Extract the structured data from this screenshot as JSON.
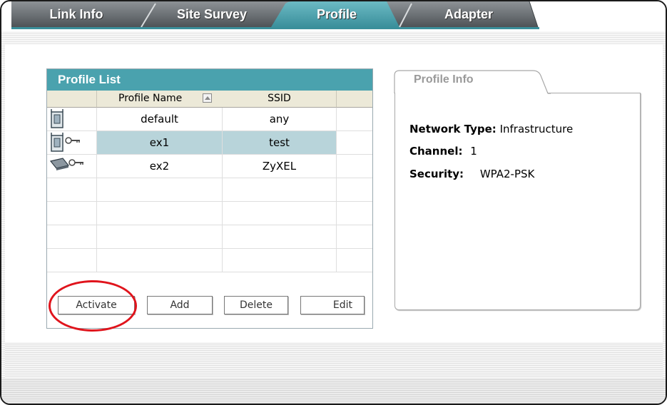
{
  "tabs": [
    {
      "label": "Link Info",
      "active": false
    },
    {
      "label": "Site Survey",
      "active": false
    },
    {
      "label": "Profile",
      "active": true
    },
    {
      "label": "Adapter",
      "active": false
    }
  ],
  "profile_list": {
    "title": "Profile List",
    "columns": [
      "Profile Name",
      "SSID"
    ],
    "rows": [
      {
        "icon": "infrastructure-ap-icon",
        "name": "default",
        "ssid": "any",
        "selected": false
      },
      {
        "icon": "infrastructure-ap-secure-icon",
        "name": "ex1",
        "ssid": "test",
        "selected": true
      },
      {
        "icon": "adhoc-secure-icon",
        "name": "ex2",
        "ssid": "ZyXEL",
        "selected": false
      }
    ],
    "buttons": {
      "activate": "Activate",
      "add": "Add",
      "delete": "Delete",
      "edit": "Edit"
    }
  },
  "profile_info": {
    "title": "Profile Info",
    "network_type_label": "Network Type:",
    "network_type_value": "Infrastructure",
    "channel_label": "Channel:",
    "channel_value": "1",
    "security_label": "Security:",
    "security_value": "WPA2-PSK"
  },
  "colors": {
    "tab_active": "#4c9fab",
    "tab_inactive": "#6f7478",
    "list_header": "#4aa2ae",
    "selected_row": "#b8d4da",
    "highlight": "#e0141c"
  }
}
